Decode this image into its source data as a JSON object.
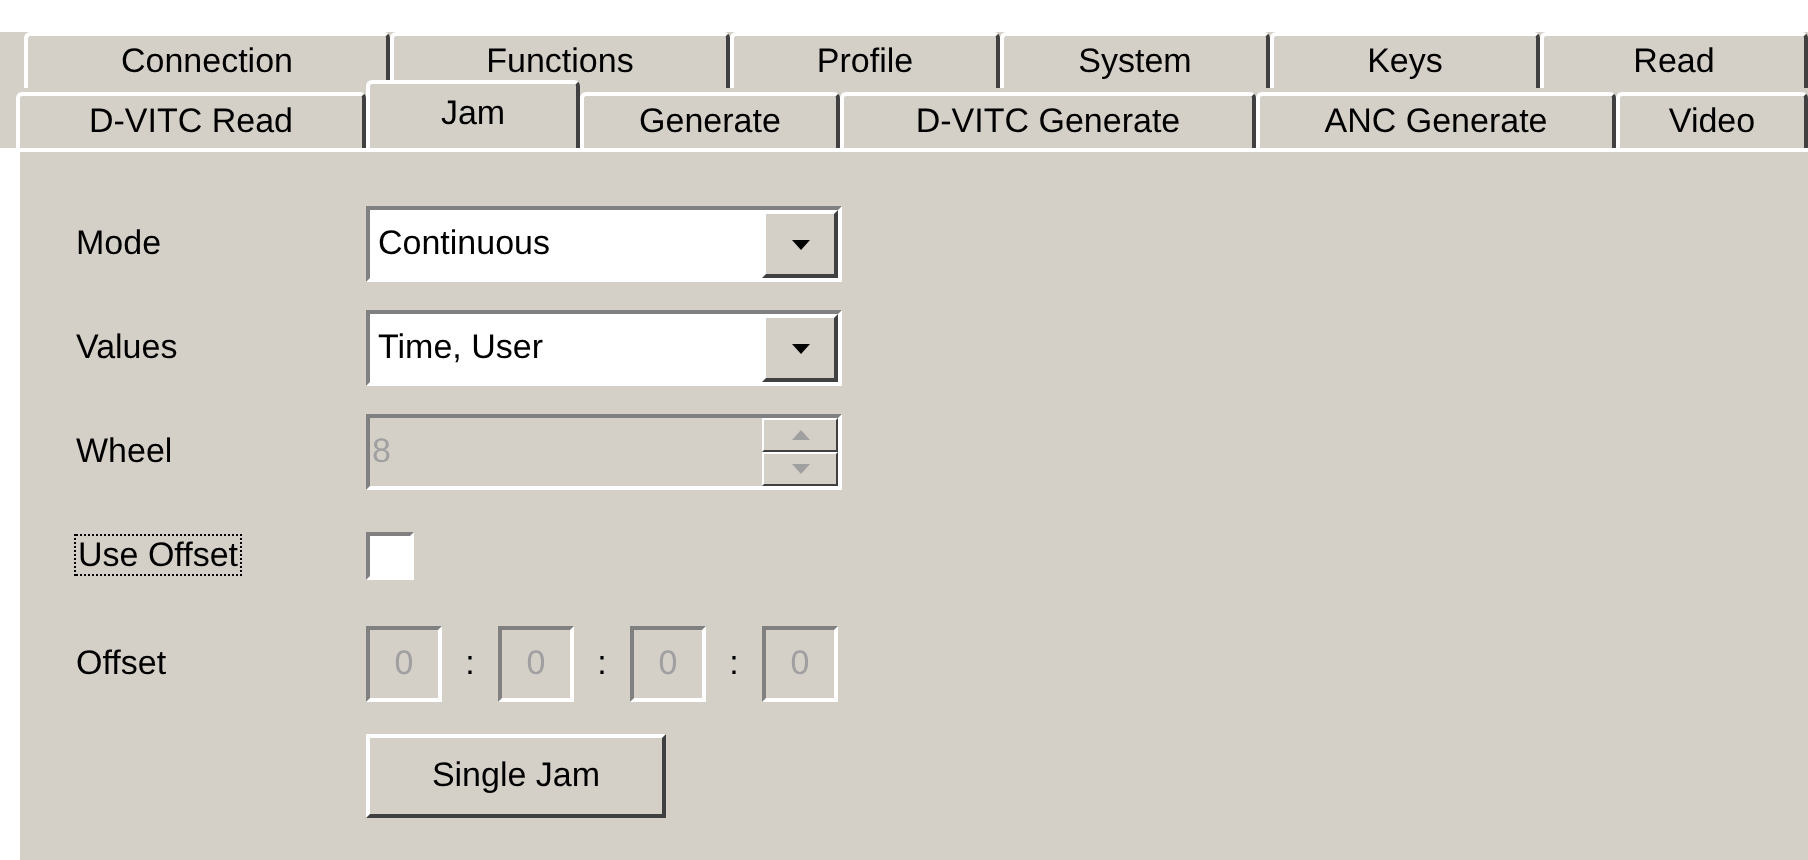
{
  "tab_rows": [
    {
      "tabs": [
        {
          "label": "Connection",
          "selected": false
        },
        {
          "label": "Functions",
          "selected": false
        },
        {
          "label": "Profile",
          "selected": false
        },
        {
          "label": "System",
          "selected": false
        },
        {
          "label": "Keys",
          "selected": false
        },
        {
          "label": "Read",
          "selected": false
        }
      ]
    },
    {
      "tabs": [
        {
          "label": "D-VITC Read",
          "selected": false
        },
        {
          "label": "Jam",
          "selected": true
        },
        {
          "label": "Generate",
          "selected": false
        },
        {
          "label": "D-VITC Generate",
          "selected": false
        },
        {
          "label": "ANC Generate",
          "selected": false
        },
        {
          "label": "Video",
          "selected": false
        }
      ]
    }
  ],
  "fields": [
    {
      "kind": "dropdown",
      "label": "Mode",
      "value": "Continuous",
      "disabled": false
    },
    {
      "kind": "dropdown",
      "label": "Values",
      "value": "Time, User",
      "disabled": false
    },
    {
      "kind": "spinner",
      "label": "Wheel",
      "value": "8",
      "disabled": true
    },
    {
      "kind": "checkbox",
      "label": "Use Offset",
      "checked": false,
      "focused": true
    },
    {
      "kind": "offset",
      "label": "Offset",
      "parts": [
        "0",
        "0",
        "0",
        "0"
      ],
      "separators": [
        ":",
        ":",
        ":"
      ],
      "disabled": true
    },
    {
      "kind": "button",
      "label": "Single Jam"
    }
  ]
}
